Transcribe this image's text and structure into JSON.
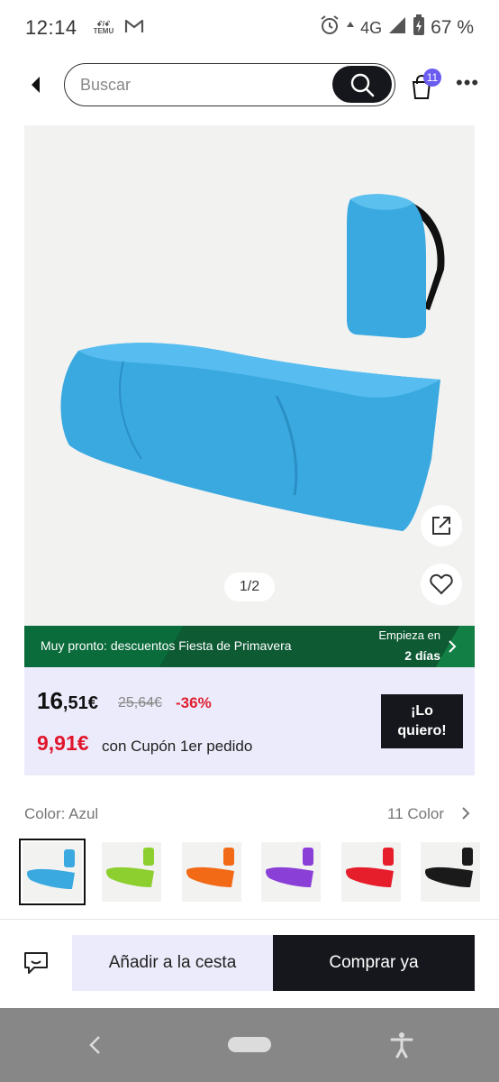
{
  "status_bar": {
    "time": "12:14",
    "temu_top": "ꗃ/ꗃ",
    "temu_bottom": "TEMU",
    "network": "4G",
    "battery": "67 %",
    "icons": [
      "alarm-icon",
      "data-arrow-icon",
      "signal-icon",
      "battery-icon",
      "gmail-icon"
    ]
  },
  "header": {
    "search_placeholder": "Buscar",
    "cart_count": "11",
    "icons": [
      "back-icon",
      "search-icon",
      "cart-icon",
      "more-icon"
    ]
  },
  "gallery": {
    "counter": "1/2",
    "product_color": "#3aa9e0",
    "icons": [
      "share-icon",
      "heart-icon"
    ]
  },
  "promo": {
    "text": "Muy pronto: descuentos Fiesta de Primavera",
    "starts_label": "Empieza en",
    "days": "2 días",
    "color": "#0a6b3b"
  },
  "price": {
    "main_int": "16",
    "main_dec": ",51€",
    "original": "25,64€",
    "discount": "-36%",
    "coupon_price": "9,91€",
    "coupon_text": "con Cupón 1er pedido",
    "cta": "¡Lo quiero!",
    "accent": "#e0152c"
  },
  "colors": {
    "label": "Color: Azul",
    "count": "11 Color",
    "swatches": [
      {
        "name": "Azul",
        "hex": "#3aa9e0",
        "selected": true
      },
      {
        "name": "Verde",
        "hex": "#8ccf2e"
      },
      {
        "name": "Naranja",
        "hex": "#f26a16"
      },
      {
        "name": "Morado",
        "hex": "#8a3fd6"
      },
      {
        "name": "Rojo",
        "hex": "#e61e2c"
      },
      {
        "name": "Negro",
        "hex": "#1a1a1a"
      }
    ]
  },
  "actions": {
    "add_to_cart": "Añadir a la cesta",
    "buy_now": "Comprar ya",
    "icons": [
      "chat-icon"
    ]
  },
  "nav": {
    "icons": [
      "nav-back-icon",
      "nav-home-pill",
      "accessibility-icon"
    ]
  }
}
